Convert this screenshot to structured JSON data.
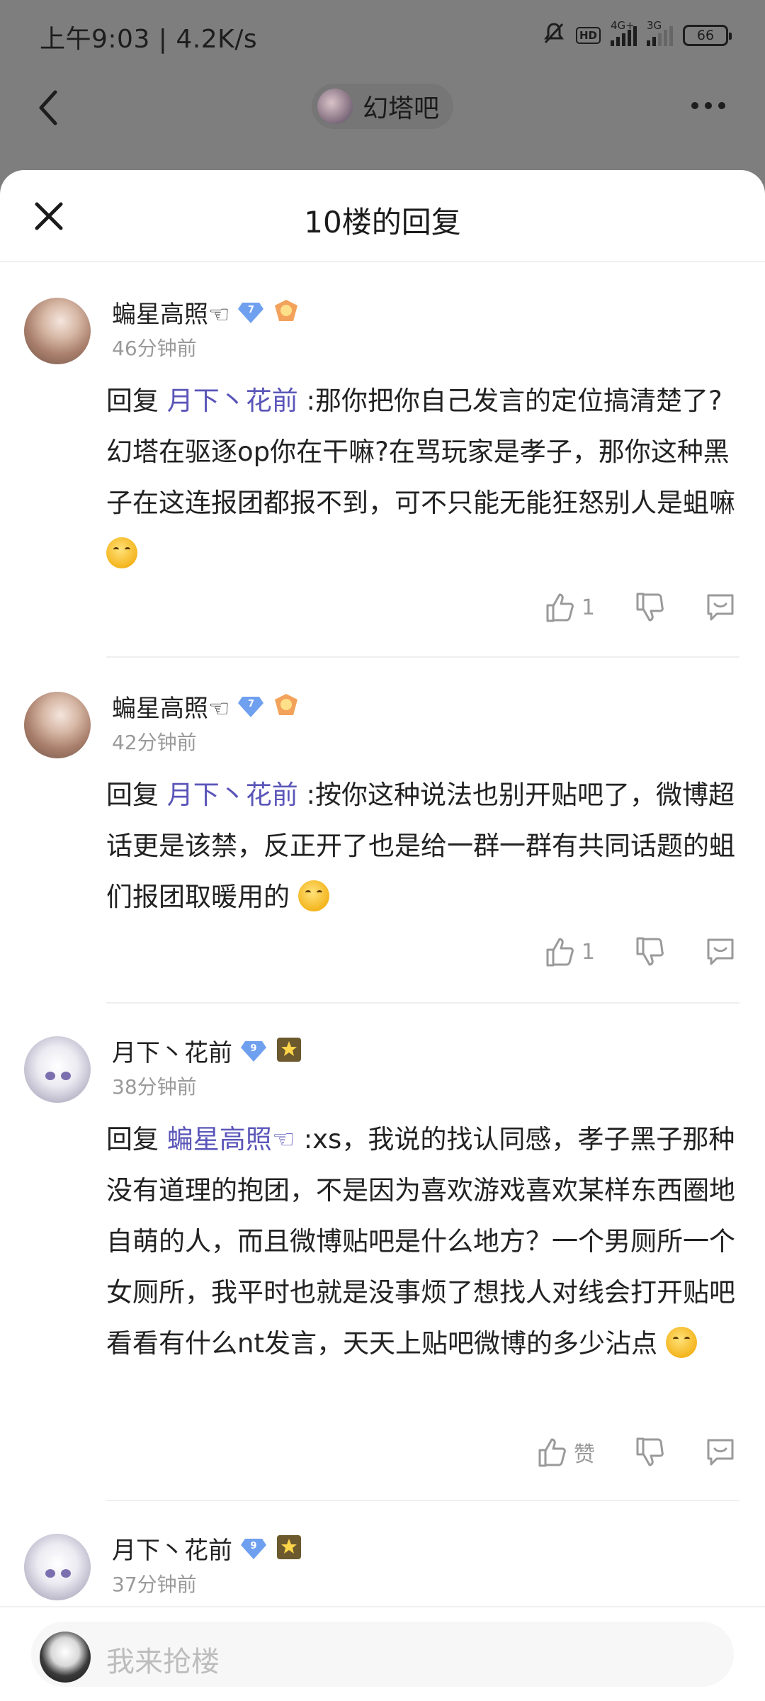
{
  "status_bar": {
    "time": "上午9:03 | 4.2K/s",
    "hd": "HD",
    "net1": "4G+",
    "net2": "3G",
    "battery": "66"
  },
  "nav": {
    "forum_name": "幻塔吧"
  },
  "sheet": {
    "title": "10楼的回复"
  },
  "replies": [
    {
      "username": "蝙星高照☜",
      "level": "7",
      "time": "46分钟前",
      "prefix": "回复 ",
      "mention": "月下丶花前",
      "text": " :那你把你自己发言的定位搞清楚了?幻塔在驱逐op你在干嘛?在骂玩家是孝子，那你这种黑子在这连报团都报不到，可不只能无能狂怒别人是蛆嘛",
      "like_label": "1"
    },
    {
      "username": "蝙星高照☜",
      "level": "7",
      "time": "42分钟前",
      "prefix": "回复 ",
      "mention": "月下丶花前",
      "text": " :按你这种说法也别开贴吧了，微博超话更是该禁，反正开了也是给一群一群有共同话题的蛆们报团取暖用的",
      "like_label": "1"
    },
    {
      "username": "月下丶花前",
      "level": "9",
      "time": "38分钟前",
      "prefix": "回复 ",
      "mention": "蝙星高照☜",
      "text": " :xs，我说的找认同感，孝子黑子那种没有道理的抱团，不是因为喜欢游戏喜欢某样东西圈地自萌的人，而且微博贴吧是什么地方？一个男厕所一个女厕所，我平时也就是没事烦了想找人对线会打开贴吧看看有什么nt发言，天天上贴吧微博的多少沾点",
      "like_label": "赞"
    },
    {
      "username": "月下丶花前",
      "level": "9",
      "time": "37分钟前"
    }
  ],
  "input": {
    "placeholder": "我来抢楼"
  }
}
